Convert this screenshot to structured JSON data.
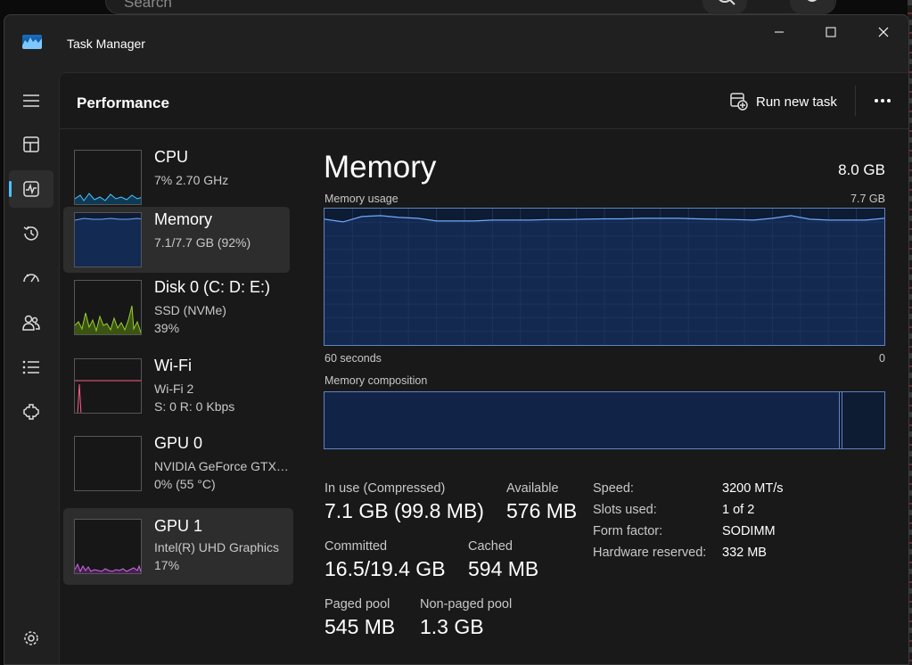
{
  "background": {
    "search_placeholder": "Search"
  },
  "window": {
    "title": "Task Manager"
  },
  "header": {
    "title": "Performance",
    "run_new_task": "Run new task"
  },
  "nav": [
    "menu-icon",
    "processes-icon",
    "performance-icon",
    "app-history-icon",
    "startup-apps-icon",
    "users-icon",
    "details-icon",
    "services-icon",
    "settings-icon"
  ],
  "resources": [
    {
      "name": "CPU",
      "sub1": "7%  2.70 GHz",
      "sub2": "",
      "color": "#4cc2ff",
      "active": false
    },
    {
      "name": "Memory",
      "sub1": "7.1/7.7 GB (92%)",
      "sub2": "",
      "color": "#6fa8ff",
      "active": true
    },
    {
      "name": "Disk 0 (C: D: E:)",
      "sub1": "SSD (NVMe)",
      "sub2": "39%",
      "color": "#9acd32",
      "active": false
    },
    {
      "name": "Wi-Fi",
      "sub1": "Wi-Fi 2",
      "sub2": "S: 0 R: 0 Kbps",
      "color": "#ff5c8a",
      "active": false
    },
    {
      "name": "GPU 0",
      "sub1": "NVIDIA GeForce GTX…",
      "sub2": "0%  (55 °C)",
      "color": "#c86fe0",
      "active": false
    },
    {
      "name": "GPU 1",
      "sub1": "Intel(R) UHD Graphics",
      "sub2": "17%",
      "color": "#c86fe0",
      "active": false
    }
  ],
  "main": {
    "title": "Memory",
    "total": "8.0 GB",
    "usage_label": "Memory usage",
    "usage_max": "7.7 GB",
    "time_span": "60 seconds",
    "time_end": "0",
    "composition_label": "Memory composition",
    "composition": {
      "in_use_fraction": 0.92,
      "modified_fraction": 0.005
    },
    "stats": {
      "in_use_label": "In use (Compressed)",
      "in_use_value": "7.1 GB (99.8 MB)",
      "available_label": "Available",
      "available_value": "576 MB",
      "committed_label": "Committed",
      "committed_value": "16.5/19.4 GB",
      "cached_label": "Cached",
      "cached_value": "594 MB",
      "paged_label": "Paged pool",
      "paged_value": "545 MB",
      "nonpaged_label": "Non-paged pool",
      "nonpaged_value": "1.3 GB"
    },
    "details": [
      {
        "label": "Speed:",
        "value": "3200 MT/s"
      },
      {
        "label": "Slots used:",
        "value": "1 of 2"
      },
      {
        "label": "Form factor:",
        "value": "SODIMM"
      },
      {
        "label": "Hardware reserved:",
        "value": "332 MB"
      }
    ]
  },
  "chart_data": {
    "type": "area",
    "title": "Memory usage",
    "xlabel": "",
    "ylabel": "",
    "xlim": [
      60,
      0
    ],
    "ylim": [
      0,
      7.7
    ],
    "x": [
      60,
      58,
      56,
      54,
      52,
      50,
      48,
      46,
      44,
      42,
      40,
      38,
      36,
      34,
      32,
      30,
      28,
      26,
      24,
      22,
      20,
      18,
      16,
      14,
      12,
      10,
      8,
      6,
      4,
      2,
      0
    ],
    "series": [
      {
        "values": [
          7.1,
          6.95,
          7.25,
          7.3,
          7.2,
          7.15,
          7.0,
          7.0,
          7.0,
          7.05,
          7.05,
          7.05,
          7.08,
          7.08,
          7.1,
          7.12,
          7.12,
          7.15,
          7.15,
          7.15,
          7.12,
          7.1,
          7.08,
          7.05,
          7.15,
          7.3,
          7.1,
          7.05,
          7.05,
          7.05,
          7.15
        ]
      }
    ],
    "grid": true
  }
}
